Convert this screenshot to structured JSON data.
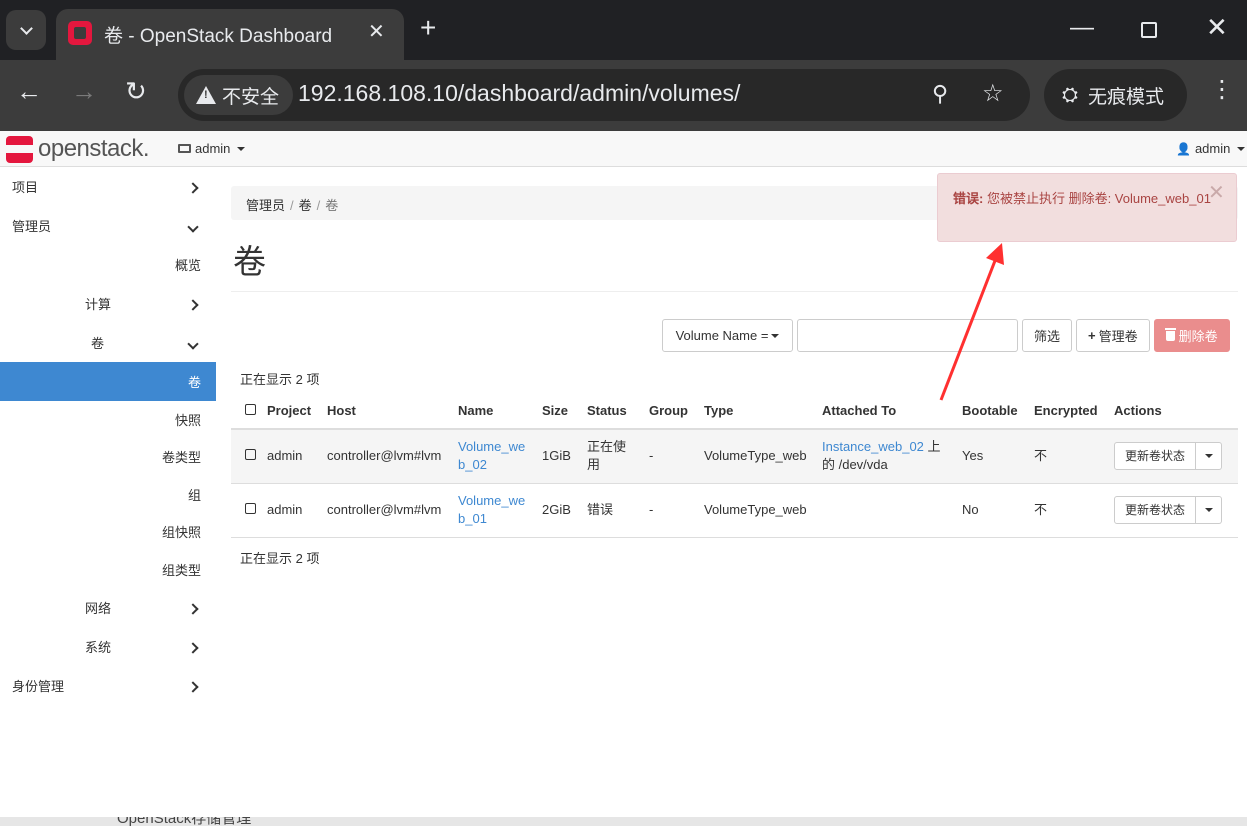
{
  "browser": {
    "tab_title": "卷 - OpenStack Dashboard",
    "security_label": "不安全",
    "url": "192.168.108.10/dashboard/admin/volumes/",
    "incognito_label": "无痕模式"
  },
  "navbar": {
    "logo_text": "openstack.",
    "project": "admin",
    "user": "admin"
  },
  "sidebar": {
    "items": [
      {
        "label": "项目"
      },
      {
        "label": "管理员"
      },
      {
        "label": "概览"
      },
      {
        "label": "计算"
      },
      {
        "label": "卷"
      },
      {
        "label": "卷"
      },
      {
        "label": "快照"
      },
      {
        "label": "卷类型"
      },
      {
        "label": "组"
      },
      {
        "label": "组快照"
      },
      {
        "label": "组类型"
      },
      {
        "label": "网络"
      },
      {
        "label": "系统"
      },
      {
        "label": "身份管理"
      }
    ]
  },
  "breadcrumb": [
    "管理员",
    "卷",
    "卷"
  ],
  "page_title": "卷",
  "filter": {
    "field_label": "Volume Name =",
    "input_value": "",
    "filter_button": "筛选",
    "manage_button": "管理卷",
    "delete_button": "删除卷"
  },
  "count_text": "正在显示 2 项",
  "table": {
    "headers": [
      "Project",
      "Host",
      "Name",
      "Size",
      "Status",
      "Group",
      "Type",
      "Attached To",
      "Bootable",
      "Encrypted",
      "Actions"
    ],
    "rows": [
      {
        "project": "admin",
        "host": "controller@lvm#lvm",
        "name_1": "Volume_we",
        "name_2": "b_02",
        "size": "1GiB",
        "status_1": "正在使",
        "status_2": "用",
        "group": "-",
        "type": "VolumeType_web",
        "attached_link": "Instance_web_02",
        "attached_suffix": " 上",
        "attached_line2": "的 /dev/vda",
        "bootable": "Yes",
        "encrypted": "不",
        "action": "更新卷状态"
      },
      {
        "project": "admin",
        "host": "controller@lvm#lvm",
        "name_1": "Volume_we",
        "name_2": "b_01",
        "size": "2GiB",
        "status_1": "错误",
        "status_2": "",
        "group": "-",
        "type": "VolumeType_web",
        "attached_link": "",
        "attached_suffix": "",
        "attached_line2": "",
        "bootable": "No",
        "encrypted": "不",
        "action": "更新卷状态"
      }
    ]
  },
  "alert": {
    "prefix": "错误:",
    "message": " 您被禁止执行 删除卷: Volume_web_01"
  },
  "taskbar_text": "OpenStack存储管理",
  "colors": {
    "accent": "#3e88d1",
    "brand": "#e4173e",
    "danger_button": "#ea8d8d",
    "alert_bg": "#f2dede",
    "alert_text": "#a94442",
    "annotation_arrow": "#ff3030"
  }
}
